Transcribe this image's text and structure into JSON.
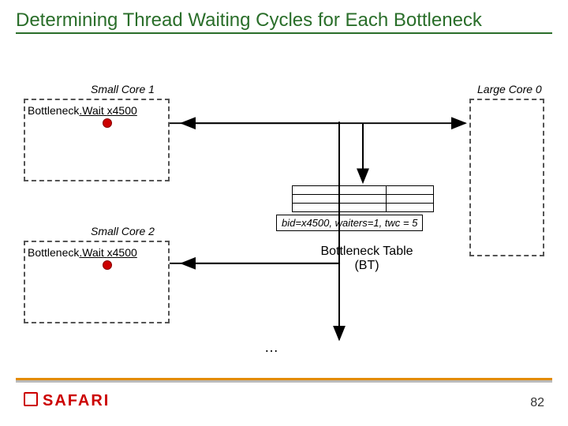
{
  "slide": {
    "title": "Determining Thread Waiting Cycles for Each Bottleneck",
    "page_number": "82",
    "brand": "SAFARI"
  },
  "cores": {
    "small1": {
      "label": "Small Core 1",
      "bw_prefix": "Bottleneck",
      "bw_mid": ".Wait ",
      "bw_addr": "x4500"
    },
    "small2": {
      "label": "Small Core 2",
      "bw_prefix": "Bottleneck",
      "bw_mid": ".Wait ",
      "bw_addr": "x4500"
    },
    "large0": {
      "label": "Large Core 0"
    }
  },
  "bt": {
    "label": "Bottleneck Table (BT)",
    "annotation": "bid=x4500, waiters=1, twc = 5"
  },
  "misc": {
    "ellipsis": "…"
  }
}
